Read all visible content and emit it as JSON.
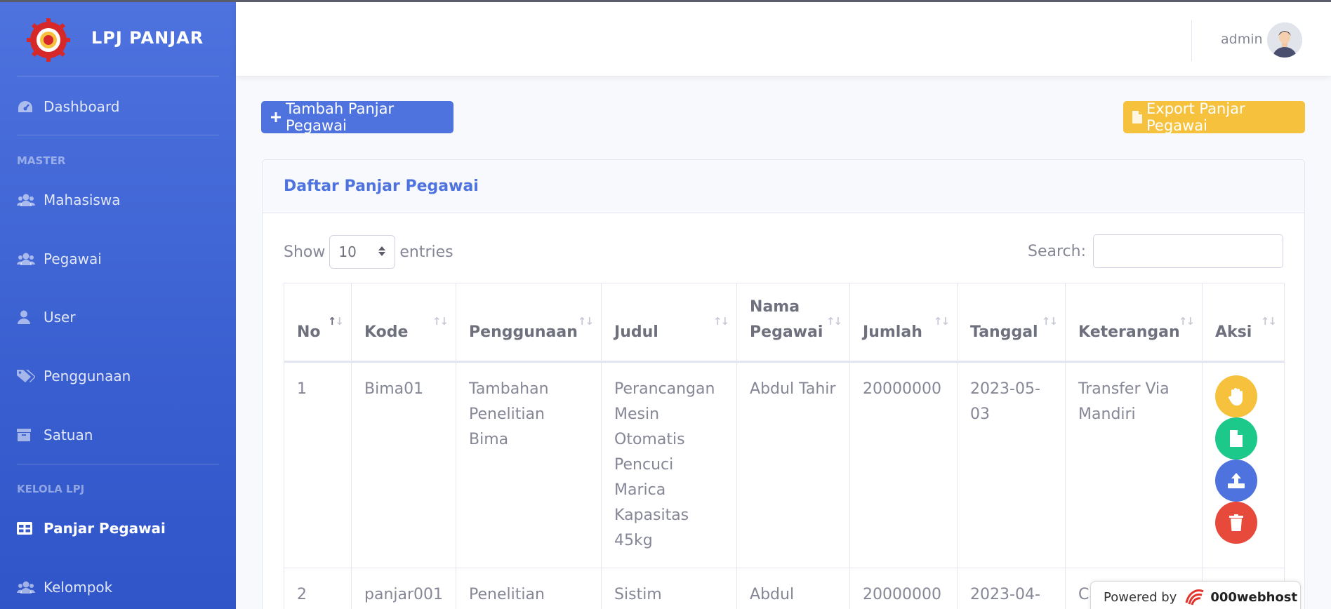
{
  "app": {
    "brand": "LPJ PANJAR"
  },
  "sidebar": {
    "headings": {
      "master": "MASTER",
      "kelola": "KELOLA LPJ"
    },
    "items": [
      {
        "label": "Dashboard",
        "icon": "tachometer-icon"
      },
      {
        "label": "Mahasiswa",
        "icon": "users-icon"
      },
      {
        "label": "Pegawai",
        "icon": "users-icon"
      },
      {
        "label": "User",
        "icon": "user-icon"
      },
      {
        "label": "Penggunaan",
        "icon": "tags-icon"
      },
      {
        "label": "Satuan",
        "icon": "archive-icon"
      },
      {
        "label": "Panjar Pegawai",
        "icon": "table-icon",
        "active": true
      },
      {
        "label": "Kelompok",
        "icon": "users-icon"
      }
    ]
  },
  "topbar": {
    "user_name": "admin"
  },
  "actions": {
    "add_label": "Tambah Panjar Pegawai",
    "export_label": "Export Panjar Pegawai"
  },
  "card": {
    "title": "Daftar Panjar Pegawai"
  },
  "datatable": {
    "show_label": "Show",
    "entries_label": "entries",
    "page_size": "10",
    "search_label": "Search:",
    "search_value": "",
    "columns": [
      "No",
      "Kode",
      "Penggunaan",
      "Judul",
      "Nama Pegawai",
      "Jumlah",
      "Tanggal",
      "Keterangan",
      "Aksi"
    ],
    "rows": [
      {
        "no": "1",
        "kode": "Bima01",
        "penggunaan": "Tambahan Penelitian Bima",
        "judul": "Perancangan Mesin Otomatis Pencuci Marica Kapasitas 45kg",
        "nama": "Abdul Tahir",
        "jumlah": "20000000",
        "tanggal": "2023-05-03",
        "keterangan": "Transfer Via Mandiri"
      },
      {
        "no": "2",
        "kode": "panjar001",
        "penggunaan": "Penelitian",
        "judul": "Sistim",
        "nama": "Abdul",
        "jumlah": "20000000",
        "tanggal": "2023-04-",
        "keterangan": "Cash"
      }
    ]
  },
  "footer_badge": {
    "powered_label": "Powered by",
    "brand": "000webhost"
  },
  "colors": {
    "primary": "#4e73df",
    "warning": "#f6c23e",
    "success": "#1cc88a",
    "danger": "#e74a3b"
  }
}
